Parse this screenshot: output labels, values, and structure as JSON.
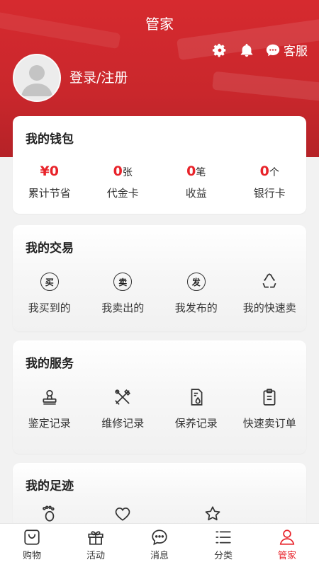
{
  "header": {
    "title": "管家",
    "kefu_label": "客服",
    "login_label": "登录/注册"
  },
  "wallet": {
    "title": "我的钱包",
    "items": [
      {
        "value": "¥0",
        "unit": "",
        "label": "累计节省"
      },
      {
        "value": "0",
        "unit": "张",
        "label": "代金卡"
      },
      {
        "value": "0",
        "unit": "笔",
        "label": "收益"
      },
      {
        "value": "0",
        "unit": "个",
        "label": "银行卡"
      }
    ]
  },
  "trade": {
    "title": "我的交易",
    "items": [
      {
        "icon_char": "买",
        "label": "我买到的",
        "icon": "buy-icon"
      },
      {
        "icon_char": "卖",
        "label": "我卖出的",
        "icon": "sell-icon"
      },
      {
        "icon_char": "发",
        "label": "我发布的",
        "icon": "publish-icon"
      },
      {
        "icon_char": "",
        "label": "我的快速卖",
        "icon": "recycle-icon"
      }
    ]
  },
  "service": {
    "title": "我的服务",
    "items": [
      {
        "label": "鉴定记录",
        "icon": "stamp-icon"
      },
      {
        "label": "维修记录",
        "icon": "tools-icon"
      },
      {
        "label": "保养记录",
        "icon": "maintenance-doc-icon"
      },
      {
        "label": "快速卖订单",
        "icon": "clipboard-icon"
      }
    ]
  },
  "footprint": {
    "title": "我的足迹",
    "icons": [
      "footprint-icon",
      "heart-icon",
      "star-icon"
    ]
  },
  "tabbar": {
    "active_color": "#e8232a",
    "items": [
      {
        "label": "购物",
        "icon": "bag-icon"
      },
      {
        "label": "活动",
        "icon": "gift-icon"
      },
      {
        "label": "消息",
        "icon": "chat-icon"
      },
      {
        "label": "分类",
        "icon": "list-icon"
      },
      {
        "label": "管家",
        "icon": "person-icon",
        "active": true
      }
    ]
  },
  "colors": {
    "brand_red": "#d62a2f",
    "accent": "#e8232a"
  }
}
